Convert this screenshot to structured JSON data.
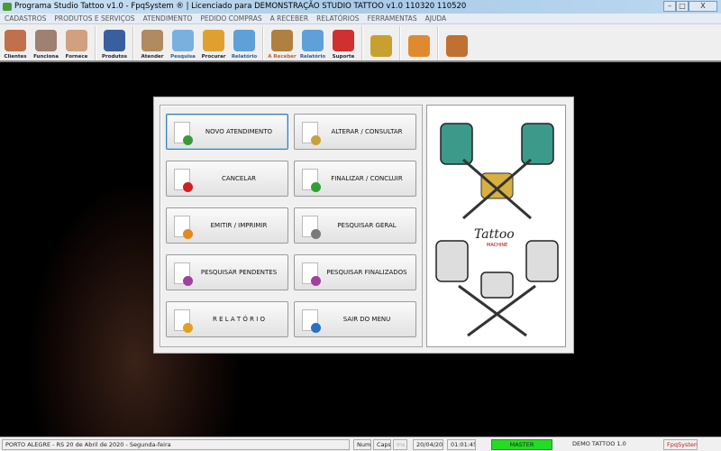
{
  "window": {
    "title": "Programa Studio Tattoo v1.0 - FpqSystem ® | Licenciado para  DEMONSTRAÇÃO STUDIO TATTOO v1.0 110320 110520",
    "minimize": "–",
    "maximize": "□",
    "close": "X"
  },
  "menu": [
    "CADASTROS",
    "PRODUTOS E SERVIÇOS",
    "ATENDIMENTO",
    "PEDIDO COMPRAS",
    "A RECEBER",
    "RELATÓRIOS",
    "FERRAMENTAS",
    "AJUDA"
  ],
  "toolbar": [
    {
      "label": "Clientes",
      "icon": "people-icon",
      "color": "#c0704a"
    },
    {
      "label": "Funciona",
      "icon": "skull-icon",
      "color": "#a08070"
    },
    {
      "label": "Fornece",
      "icon": "person-icon",
      "color": "#d0a080"
    },
    {
      "label": "Produtos",
      "icon": "list-icon",
      "color": "#3a5fa0"
    },
    {
      "label": "Atender",
      "icon": "tattoo-icon",
      "color": "#b08a60"
    },
    {
      "label": "Pesquisa",
      "icon": "search-icon",
      "color": "#7ab0e0"
    },
    {
      "label": "Procurar",
      "icon": "folder-icon",
      "color": "#e0a030"
    },
    {
      "label": "Relatório",
      "icon": "printer-icon",
      "color": "#60a0d8"
    },
    {
      "label": "A Receber",
      "icon": "money-icon",
      "color": "#b08040"
    },
    {
      "label": "Relatório",
      "icon": "printer-icon",
      "color": "#60a0d8"
    },
    {
      "label": "Suporte",
      "icon": "support-icon",
      "color": "#d03030"
    },
    {
      "label": "",
      "icon": "coin-icon",
      "color": "#c8a030"
    },
    {
      "label": "",
      "icon": "calculator-icon",
      "color": "#e08a30"
    },
    {
      "label": "",
      "icon": "exit-icon",
      "color": "#c07030"
    }
  ],
  "buttons": [
    {
      "label": "NOVO ATENDIMENTO",
      "icon": "new-document-icon",
      "badge": "#3a9a3a"
    },
    {
      "label": "ALTERAR  /  CONSULTAR",
      "icon": "edit-icon",
      "badge": "#c8a040"
    },
    {
      "label": "CANCELAR",
      "icon": "cancel-document-icon",
      "badge": "#d02020"
    },
    {
      "label": "FINALIZAR  /  CONCLUIR",
      "icon": "check-document-icon",
      "badge": "#30a030"
    },
    {
      "label": "EMITIR  /  IMPRIMIR",
      "icon": "print-person-icon",
      "badge": "#e08a20"
    },
    {
      "label": "PESQUISAR GERAL",
      "icon": "search-icon",
      "badge": "#7a7a7a"
    },
    {
      "label": "PESQUISAR PENDENTES",
      "icon": "pending-icon",
      "badge": "#a040a0"
    },
    {
      "label": "PESQUISAR FINALIZADOS",
      "icon": "finished-icon",
      "badge": "#a040a0"
    },
    {
      "label": "R E L A T Ó R I O",
      "icon": "report-icon",
      "badge": "#e0a020"
    },
    {
      "label": "SAIR DO MENU",
      "icon": "exit-icon",
      "badge": "#2a70c0"
    }
  ],
  "image": {
    "logo_text": "Tattoo",
    "logo_sub": "MACHINE"
  },
  "status": {
    "location": "PORTO ALEGRE - RS 20 de Abril de 2020 - Segunda-feira",
    "num": "Num",
    "caps": "Caps",
    "ins": "Ins",
    "date": "20/04/20",
    "time": "01:01:45",
    "user": "MASTER",
    "user_color": "#22dd22",
    "version": "DEMO TATTOO 1.0",
    "brand": "FpqSystem"
  }
}
